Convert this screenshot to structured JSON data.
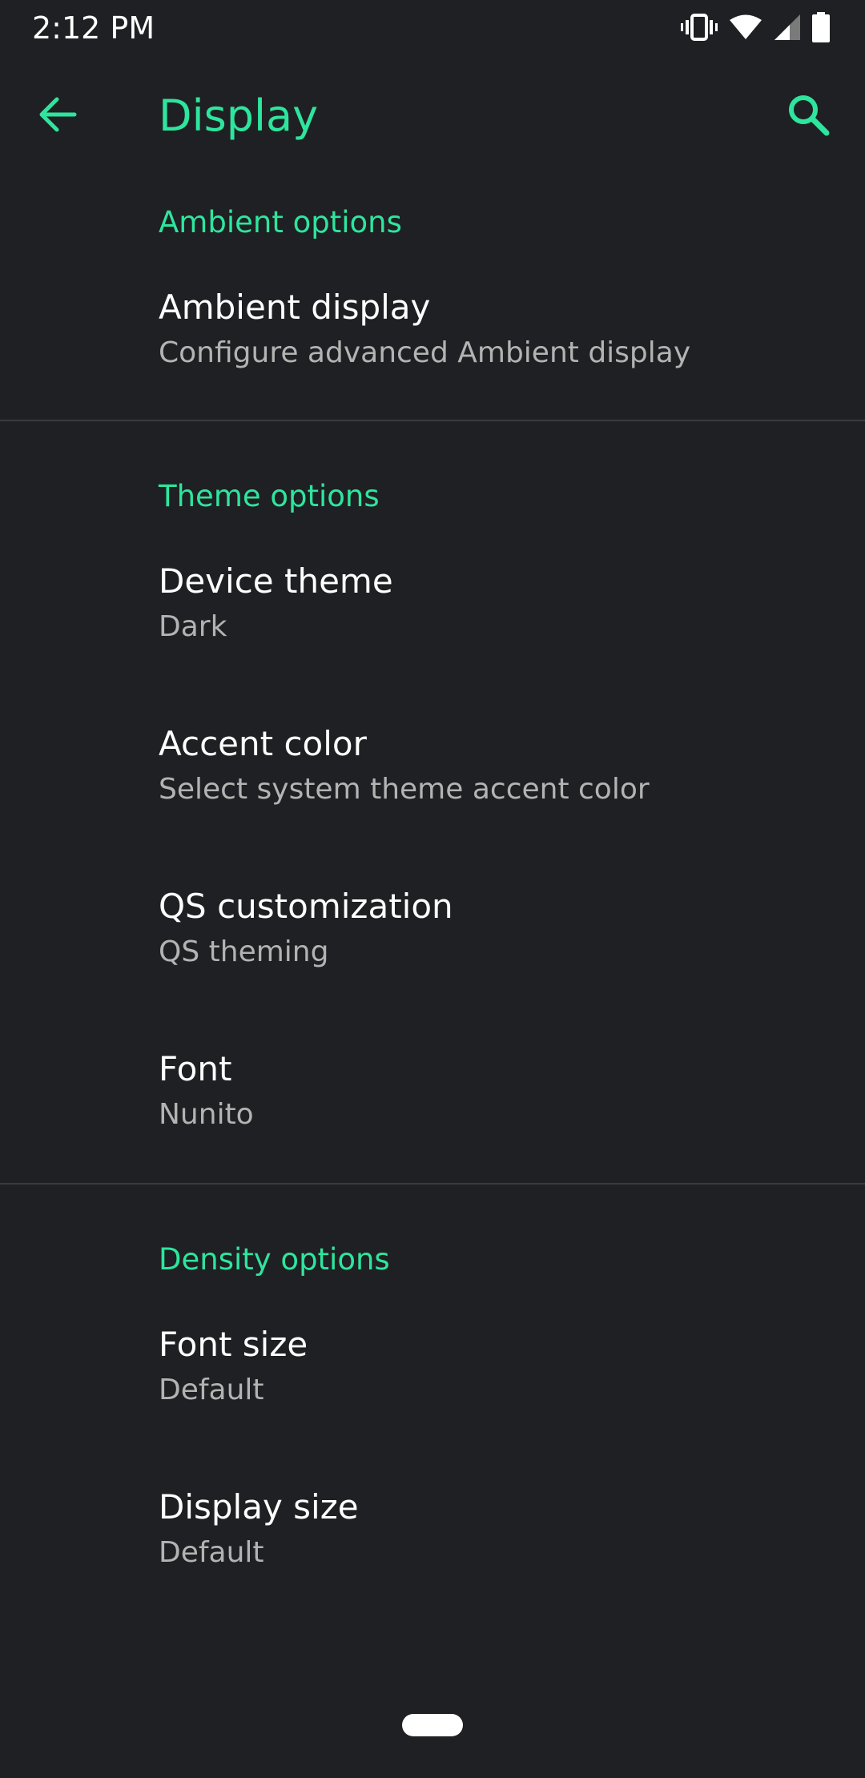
{
  "status_bar": {
    "time": "2:12 PM",
    "icons": [
      "vibrate-icon",
      "wifi-icon",
      "cell-signal-icon",
      "battery-icon"
    ]
  },
  "toolbar": {
    "title": "Display",
    "back_icon": "arrow-left-icon",
    "search_icon": "search-icon"
  },
  "colors": {
    "background": "#1f2023",
    "accent": "#2ee59d",
    "text_primary": "#ffffff",
    "text_secondary": "#b3b3b3",
    "divider": "#3a3b3f"
  },
  "sections": [
    {
      "header": "Ambient options",
      "items": [
        {
          "title": "Ambient display",
          "summary": "Configure advanced Ambient display"
        }
      ]
    },
    {
      "header": "Theme options",
      "items": [
        {
          "title": "Device theme",
          "summary": "Dark"
        },
        {
          "title": "Accent color",
          "summary": "Select system theme accent color"
        },
        {
          "title": "QS customization",
          "summary": "QS theming"
        },
        {
          "title": "Font",
          "summary": "Nunito"
        }
      ]
    },
    {
      "header": "Density options",
      "items": [
        {
          "title": "Font size",
          "summary": "Default"
        },
        {
          "title": "Display size",
          "summary": "Default"
        }
      ]
    }
  ]
}
